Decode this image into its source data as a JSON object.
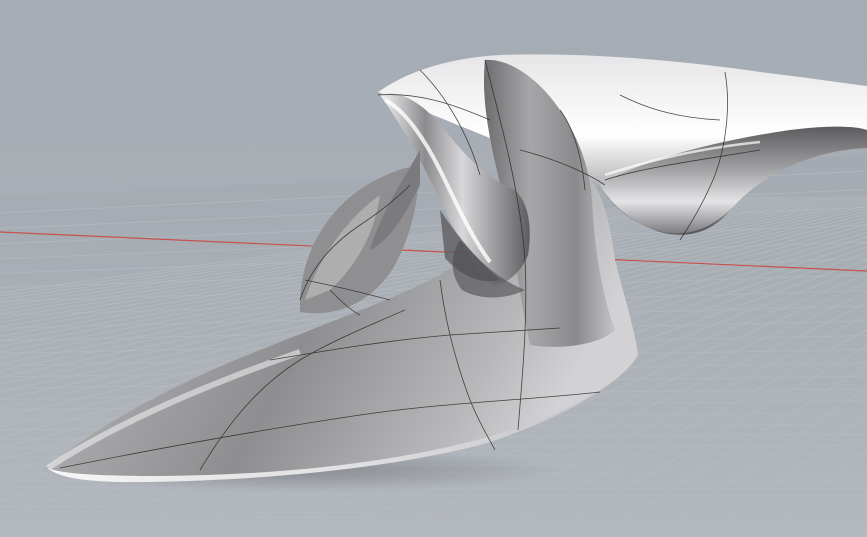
{
  "viewport": {
    "projection": "perspective",
    "display_mode": "rendered",
    "background_color": "#a9afb6",
    "construction_plane": {
      "grid": true,
      "grid_color": "#9ea4ab",
      "grid_line_color": "#b7bcc2",
      "x_axis_color": "#c7524d",
      "y_axis_visible": false
    },
    "model": {
      "object_type": "freeform surface",
      "shading": "metallic",
      "base_color": "#9c9c9e",
      "highlight_color": "#ffffff",
      "isocurves": true,
      "isocurve_color": "#2a2a2a"
    }
  }
}
